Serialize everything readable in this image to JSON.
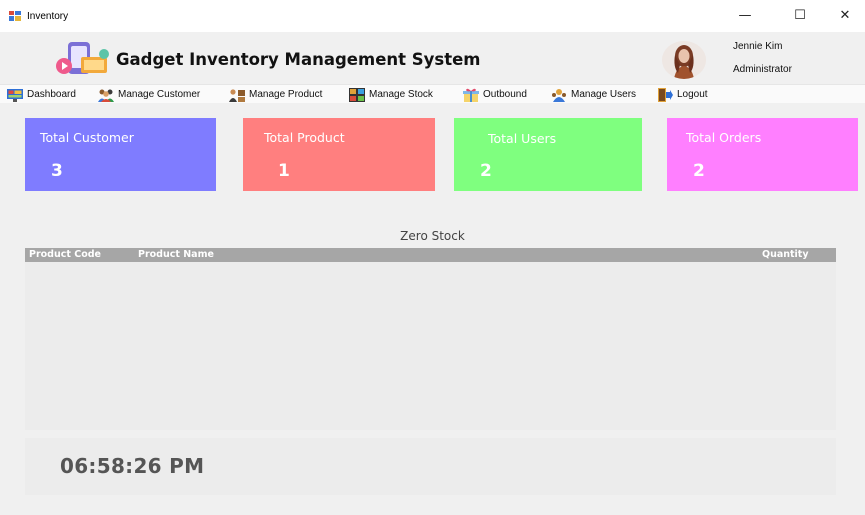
{
  "window": {
    "title": "Inventory",
    "minimize_symbol": "—",
    "maximize_symbol": "☐",
    "close_symbol": "✕"
  },
  "header": {
    "app_name": "Gadget Inventory Management System",
    "user_name": "Jennie Kim",
    "user_role": "Administrator"
  },
  "menu": {
    "items": [
      {
        "label": "Dashboard",
        "icon": "monitor-icon"
      },
      {
        "label": "Manage Customer",
        "icon": "customers-icon"
      },
      {
        "label": "Manage Product",
        "icon": "products-icon"
      },
      {
        "label": "Manage Stock",
        "icon": "stock-icon"
      },
      {
        "label": "Outbound",
        "icon": "gift-box-icon"
      },
      {
        "label": "Manage Users",
        "icon": "users-icon"
      },
      {
        "label": "Logout",
        "icon": "exit-door-icon"
      }
    ]
  },
  "stats": [
    {
      "title": "Total Customer",
      "value": "3",
      "color": "#7f7cff"
    },
    {
      "title": "Total Product",
      "value": "1",
      "color": "#ff7f7f"
    },
    {
      "title": "Total Users",
      "value": "2",
      "color": "#7fff7f"
    },
    {
      "title": "Total Orders",
      "value": "2",
      "color": "#ff7fff"
    }
  ],
  "zero_stock": {
    "title": "Zero Stock",
    "columns": [
      "Product Code",
      "Product Name",
      "Quantity"
    ],
    "rows": []
  },
  "clock": {
    "time": "06:58:26 PM"
  },
  "colors": {
    "grid_header": "#a6a6a6",
    "panel": "#ececec",
    "window_bg": "#f0f0f0"
  }
}
